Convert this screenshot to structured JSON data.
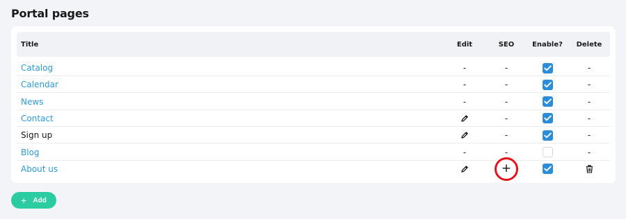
{
  "page": {
    "title": "Portal pages"
  },
  "table": {
    "headers": {
      "title": "Title",
      "edit": "Edit",
      "seo": "SEO",
      "enable": "Enable?",
      "delete": "Delete"
    },
    "dash": "-",
    "rows": [
      {
        "title": "Catalog",
        "link": true,
        "edit": "dash",
        "seo": "dash",
        "enabled": true,
        "delete": "dash"
      },
      {
        "title": "Calendar",
        "link": true,
        "edit": "dash",
        "seo": "dash",
        "enabled": true,
        "delete": "dash"
      },
      {
        "title": "News",
        "link": true,
        "edit": "dash",
        "seo": "dash",
        "enabled": true,
        "delete": "dash"
      },
      {
        "title": "Contact",
        "link": true,
        "edit": "pencil",
        "seo": "dash",
        "enabled": true,
        "delete": "dash"
      },
      {
        "title": "Sign up",
        "link": false,
        "edit": "pencil",
        "seo": "dash",
        "enabled": true,
        "delete": "dash"
      },
      {
        "title": "Blog",
        "link": true,
        "edit": "dash",
        "seo": "dash",
        "enabled": false,
        "delete": "dash"
      },
      {
        "title": "About us",
        "link": true,
        "edit": "pencil",
        "seo": "plus",
        "enabled": true,
        "delete": "trash"
      }
    ]
  },
  "icons": {
    "edit": "pencil-icon",
    "seo_add": "plus-icon",
    "delete": "trash-icon",
    "check": "checkmark-icon"
  },
  "highlight": {
    "row": 6,
    "column": "seo",
    "color": "#e4121b"
  },
  "actions": {
    "add_label": "Add"
  },
  "colors": {
    "link": "#2e9bd6",
    "checkbox": "#2b8cd8",
    "add_button": "#2ccca3",
    "background": "#f3f4f8"
  }
}
